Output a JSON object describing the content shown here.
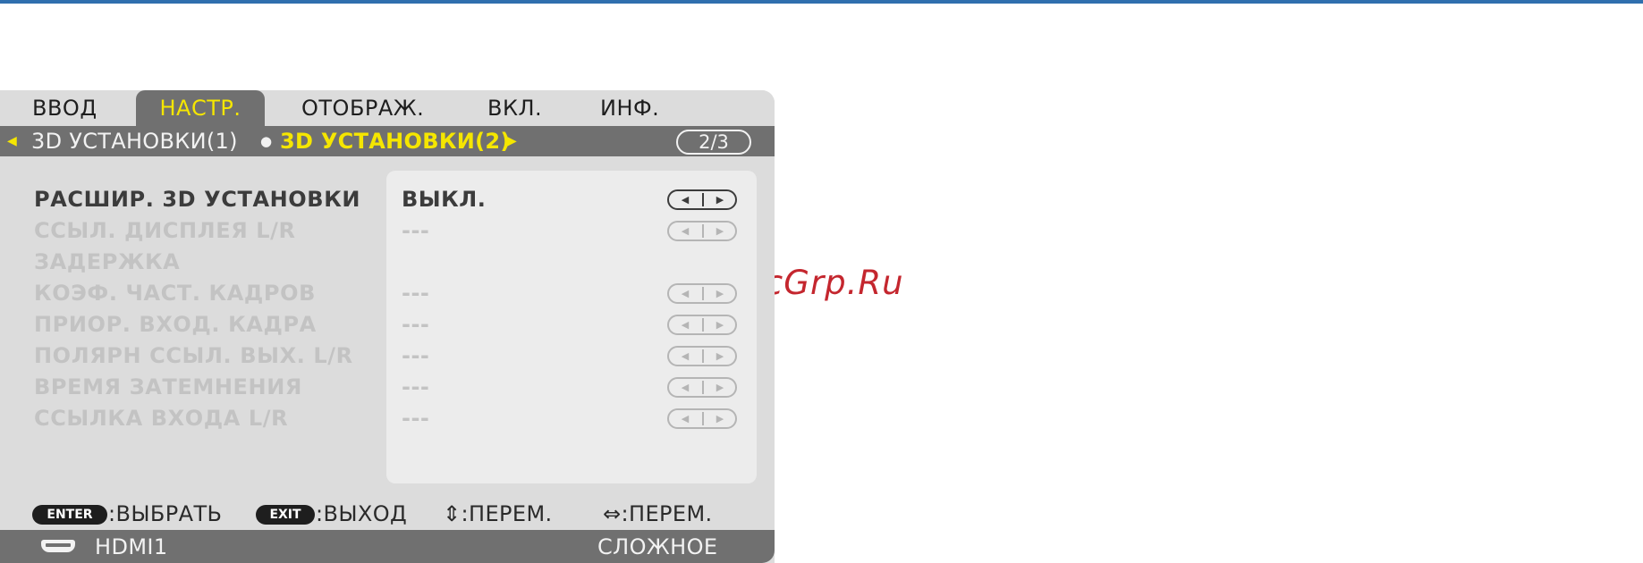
{
  "watermark": "McGrp.Ru",
  "colors": {
    "top_line": "#2f6fae",
    "active_tab_text": "#f5e600",
    "bar_gray": "#707070",
    "panel_gray": "#dcdcdc",
    "watermark": "#c4262e"
  },
  "tabs": [
    {
      "label": "ВВОД",
      "active": false
    },
    {
      "label": "НАСТР.",
      "active": true
    },
    {
      "label": "ОТОБРАЖ.",
      "active": false
    },
    {
      "label": "ВКЛ.",
      "active": false
    },
    {
      "label": "ИНФ.",
      "active": false
    }
  ],
  "subtabs": {
    "left_arrow": "◀",
    "items": [
      {
        "label": "3D УСТАНОВКИ(1)",
        "selected": false
      },
      {
        "label": "3D УСТАНОВКИ(2)",
        "selected": true
      }
    ],
    "separator": "●",
    "right_arrow": "▶",
    "page": "2/3"
  },
  "settings": [
    {
      "label": "РАСШИР. 3D УСТАНОВКИ",
      "value": "ВЫКЛ.",
      "enabled": true,
      "has_arrows": true
    },
    {
      "label": "ССЫЛ. ДИСПЛЕЯ L/R",
      "value": "---",
      "enabled": false,
      "has_arrows": true
    },
    {
      "label": "ЗАДЕРЖКА",
      "value": "",
      "enabled": false,
      "has_arrows": false
    },
    {
      "label": "КОЭФ. ЧАСТ. КАДРОВ",
      "value": "---",
      "enabled": false,
      "has_arrows": true
    },
    {
      "label": "ПРИОР. ВХОД. КАДРА",
      "value": "---",
      "enabled": false,
      "has_arrows": true
    },
    {
      "label": "ПОЛЯРН ССЫЛ. ВЫХ. L/R",
      "value": "---",
      "enabled": false,
      "has_arrows": true
    },
    {
      "label": "ВРЕМЯ ЗАТЕМНЕНИЯ",
      "value": "---",
      "enabled": false,
      "has_arrows": true
    },
    {
      "label": "ССЫЛКА ВХОДА L/R",
      "value": "---",
      "enabled": false,
      "has_arrows": true
    }
  ],
  "arrow_glyphs": {
    "left": "◀",
    "right": "▶"
  },
  "help": {
    "enter_key": "ENTER",
    "enter_text": ":ВЫБРАТЬ",
    "exit_key": "EXIT",
    "exit_text": ":ВЫХОД",
    "updown_text": "⇕:ПЕРЕМ.",
    "leftright_text": "⇔:ПЕРЕМ."
  },
  "source": {
    "icon": "hdmi-connector-icon",
    "input": "HDMI1",
    "mode": "СЛОЖНОЕ"
  }
}
